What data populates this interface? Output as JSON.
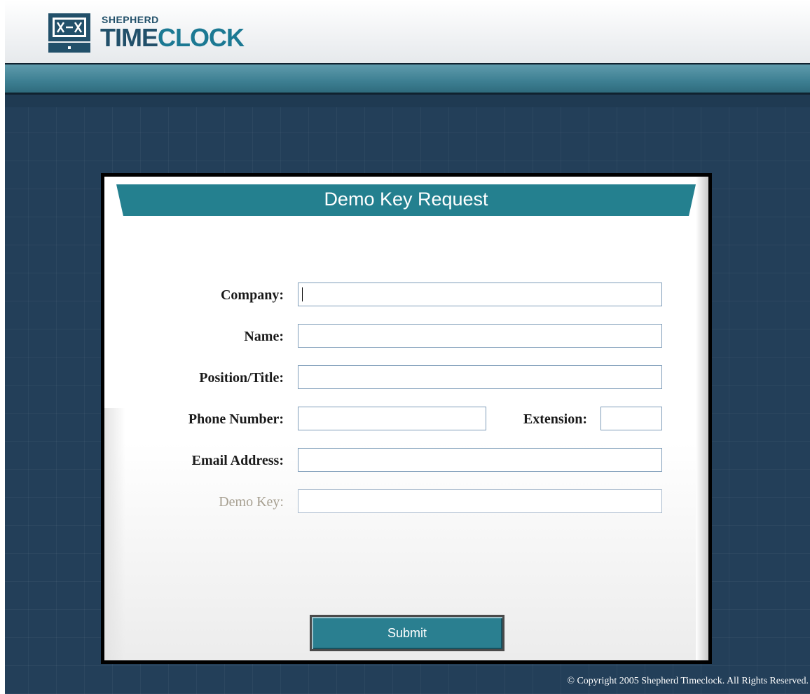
{
  "header": {
    "logo_small": "SHEPHERD",
    "logo_time": "TIME",
    "logo_clock": "CLOCK"
  },
  "form": {
    "title": "Demo Key Request",
    "fields": {
      "company": {
        "label": "Company:",
        "value": ""
      },
      "name": {
        "label": "Name:",
        "value": ""
      },
      "position": {
        "label": "Position/Title:",
        "value": ""
      },
      "phone": {
        "label": "Phone Number:",
        "value": ""
      },
      "extension": {
        "label": "Extension:",
        "value": ""
      },
      "email": {
        "label": "Email Address:",
        "value": ""
      },
      "demo_key": {
        "label": "Demo Key:",
        "value": ""
      }
    },
    "submit_label": "Submit"
  },
  "footer": {
    "copyright": "© Copyright 2005 Shepherd Timeclock. All Rights Reserved."
  },
  "colors": {
    "page_background": "#233f59",
    "banner": "#24808f",
    "submit_button": "#2a7f90",
    "disabled_label": "#a69f90"
  }
}
